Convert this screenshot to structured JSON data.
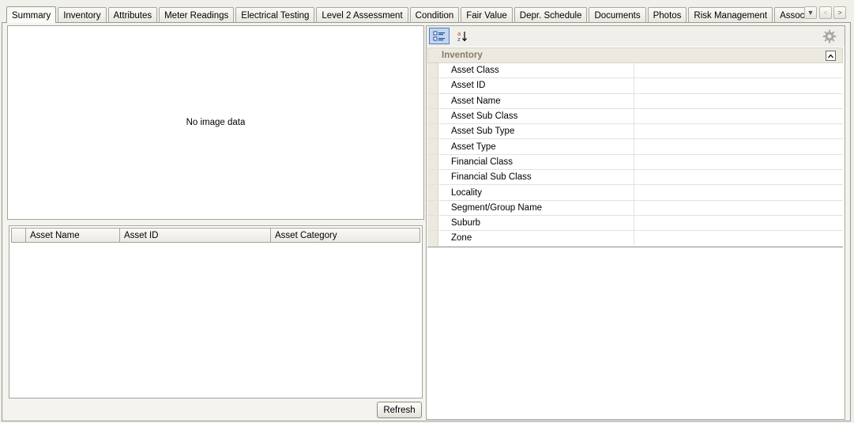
{
  "tabs": [
    {
      "label": "Summary",
      "active": true
    },
    {
      "label": "Inventory"
    },
    {
      "label": "Attributes"
    },
    {
      "label": "Meter Readings"
    },
    {
      "label": "Electrical Testing"
    },
    {
      "label": "Level 2 Assessment"
    },
    {
      "label": "Condition"
    },
    {
      "label": "Fair Value"
    },
    {
      "label": "Depr. Schedule"
    },
    {
      "label": "Documents"
    },
    {
      "label": "Photos"
    },
    {
      "label": "Risk Management"
    },
    {
      "label": "Associated Assets"
    }
  ],
  "image_panel": {
    "text": "No image data"
  },
  "grid": {
    "columns": [
      "Asset Name",
      "Asset ID",
      "Asset Category"
    ]
  },
  "refresh_label": "Refresh",
  "properties": {
    "category": "Inventory",
    "rows": [
      "Asset Class",
      "Asset ID",
      "Asset Name",
      "Asset Sub Class",
      "Asset Sub Type",
      "Asset Type",
      "Financial Class",
      "Financial Sub Class",
      "Locality",
      "Segment/Group Name",
      "Suburb",
      "Zone"
    ]
  },
  "colors": {
    "category_text": "#8a7c63",
    "selected_button": "#c4d6ee"
  }
}
